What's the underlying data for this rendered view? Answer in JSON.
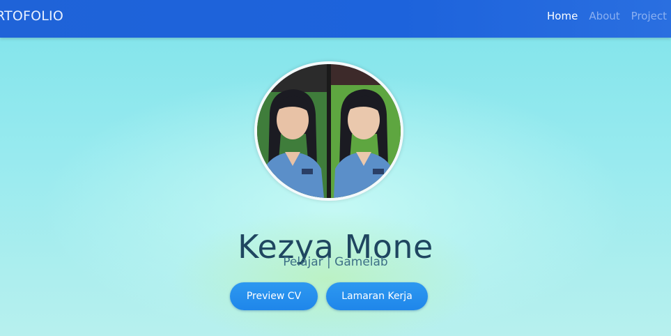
{
  "navbar": {
    "brand": "RTOFOLIO",
    "links": [
      {
        "label": "Home",
        "active": true
      },
      {
        "label": "About",
        "active": false
      },
      {
        "label": "Project",
        "active": false
      }
    ]
  },
  "hero": {
    "name": "Kezya Mone",
    "subtitle": "Pelajar | Gamelab",
    "buttons": {
      "preview_cv": "Preview CV",
      "lamaran_kerja": "Lamaran Kerja"
    }
  },
  "colors": {
    "navbar": "#1f63d8",
    "button": "#2591ee",
    "name_text": "#1f4660",
    "background": "#8fe8ee"
  }
}
